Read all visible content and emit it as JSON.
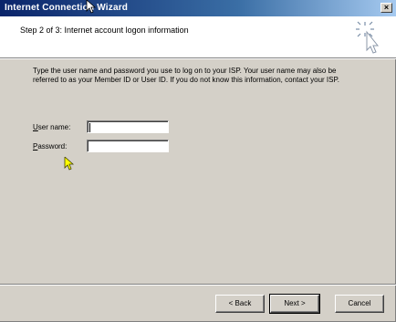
{
  "window": {
    "title": "Internet Connection Wizard",
    "close_glyph": "×"
  },
  "header": {
    "step_title": "Step 2 of 3: Internet account logon information"
  },
  "body": {
    "description": "Type the user name and password you use to log on to your ISP. Your user name may also be referred to as your Member ID or User ID. If you do not know this information, contact your ISP."
  },
  "form": {
    "username_label_first": "U",
    "username_label_rest": "ser name:",
    "username_value": "",
    "password_label_first": "P",
    "password_label_rest": "assword:",
    "password_value": ""
  },
  "buttons": {
    "back": "< Back",
    "next": "Next >",
    "cancel": "Cancel"
  },
  "colors": {
    "title_gradient_start": "#0a246a",
    "title_gradient_end": "#a6caf0",
    "dialog_face": "#d4d0c8",
    "cursor_yellow": "#ffff00"
  }
}
